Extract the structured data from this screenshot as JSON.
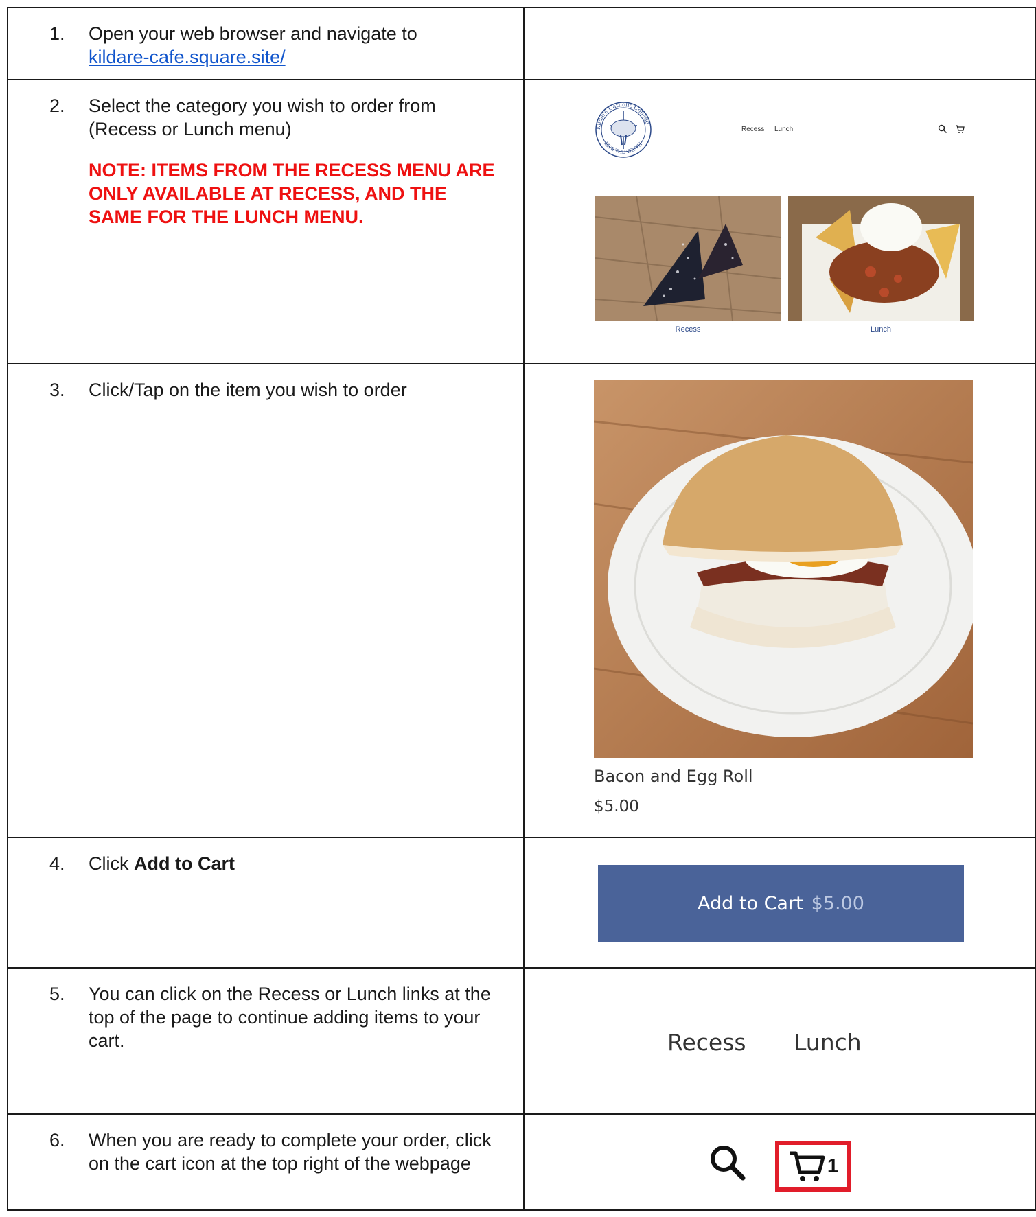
{
  "steps": [
    {
      "num": "1.",
      "text": "Open your web browser and navigate to",
      "link": "kildare-cafe.square.site/"
    },
    {
      "num": "2.",
      "text": "Select the category you wish to order from (Recess or Lunch menu)",
      "note": "NOTE: ITEMS FROM THE RECESS MENU ARE ONLY AVAILABLE AT RECESS, AND THE SAME FOR THE LUNCH MENU."
    },
    {
      "num": "3.",
      "text": "Click/Tap on the item you wish to order"
    },
    {
      "num": "4.",
      "text_pre": "Click ",
      "text_bold": "Add to Cart"
    },
    {
      "num": "5.",
      "text": "You can click on the Recess or Lunch links at the top of the page to continue adding items to your cart."
    },
    {
      "num": "6.",
      "text": "When you are ready to complete your order, click on the cart icon at the top right of the webpage"
    }
  ],
  "mini_site": {
    "logo_top": "Kildare Catholic College",
    "logo_bottom": "LIVE THE TRUTH",
    "nav": [
      "Recess",
      "Lunch"
    ],
    "categories": [
      "Recess",
      "Lunch"
    ]
  },
  "product": {
    "name": "Bacon and Egg Roll",
    "price": "$5.00"
  },
  "add_to_cart": {
    "label": "Add to Cart",
    "price": "$5.00",
    "color": "#4a6399"
  },
  "big_nav": [
    "Recess",
    "Lunch"
  ],
  "cart": {
    "count": "1",
    "highlight_color": "#e11d2a"
  },
  "icons": [
    "search-icon",
    "cart-icon"
  ]
}
